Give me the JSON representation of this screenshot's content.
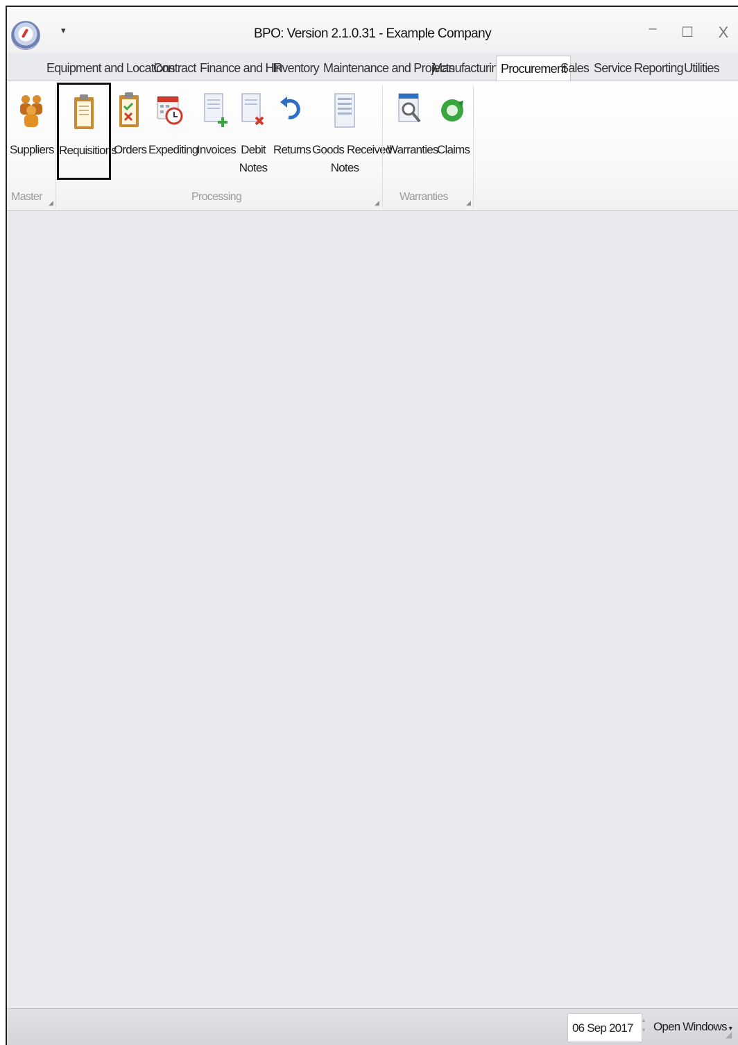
{
  "titlebar": {
    "title": "BPO: Version 2.1.0.31 - Example Company",
    "qat_arrow": "▾",
    "minimize": "–",
    "maximize": "☐",
    "close": "X"
  },
  "tabs": [
    {
      "label": "Equipment and Locations"
    },
    {
      "label": "Contract"
    },
    {
      "label": "Finance and HR"
    },
    {
      "label": "Inventory"
    },
    {
      "label": "Maintenance and Projects"
    },
    {
      "label": "Manufacturing"
    },
    {
      "label": "Procurement",
      "active": true
    },
    {
      "label": "Sales"
    },
    {
      "label": "Service"
    },
    {
      "label": "Reporting"
    },
    {
      "label": "Utilities"
    }
  ],
  "ribbon": {
    "groups": {
      "master": "Master",
      "processing": "Processing",
      "warranties": "Warranties"
    },
    "buttons": {
      "suppliers": "Suppliers",
      "requisitions": "Requisitions",
      "orders": "Orders",
      "expediting": "Expediting",
      "invoices": "Invoices",
      "debit_notes_1": "Debit",
      "debit_notes_2": "Notes",
      "returns": "Returns",
      "grn_1": "Goods Received",
      "grn_2": "Notes",
      "warranties": "Warranties",
      "claims": "Claims"
    },
    "icons": {
      "suppliers": "people-group-icon",
      "requisitions": "clipboard-icon",
      "orders": "clipboard-check-icon",
      "expediting": "calendar-clock-icon",
      "invoices": "document-add-icon",
      "debit_notes": "document-delete-icon",
      "returns": "return-arrow-icon",
      "goods_received_notes": "document-icon",
      "warranties": "document-magnifier-icon",
      "claims": "refresh-icon"
    }
  },
  "statusbar": {
    "date": "06 Sep 2017",
    "open_windows": "Open Windows",
    "caret": "▾"
  },
  "colors": {
    "workspace": "#e9eaed",
    "ribbon": "#ffffff",
    "accent_red": "#d23b2c",
    "accent_green": "#3aa640",
    "accent_blue": "#2d6fc4"
  }
}
